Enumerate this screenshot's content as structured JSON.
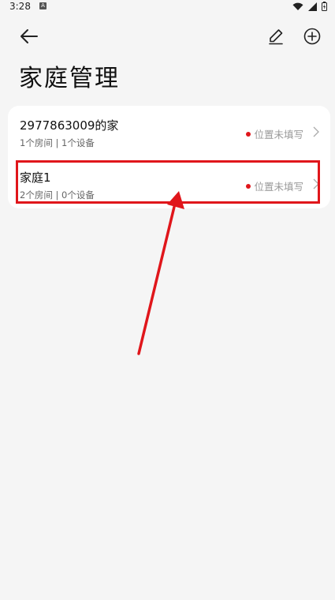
{
  "status_bar": {
    "time": "3:28",
    "notif_letter": "A"
  },
  "page": {
    "title": "家庭管理"
  },
  "homes": [
    {
      "name": "2977863009的家",
      "meta": "1个房间 | 1个设备",
      "status": "位置未填写"
    },
    {
      "name": "家庭1",
      "meta": "2个房间 | 0个设备",
      "status": "位置未填写"
    }
  ],
  "colors": {
    "accent": "#e0161b",
    "background": "#f5f5f5",
    "card": "#ffffff"
  },
  "icons": [
    "back-arrow-icon",
    "edit-pencil-icon",
    "add-circle-icon",
    "chevron-right-icon",
    "wifi-icon",
    "signal-icon",
    "battery-icon"
  ]
}
